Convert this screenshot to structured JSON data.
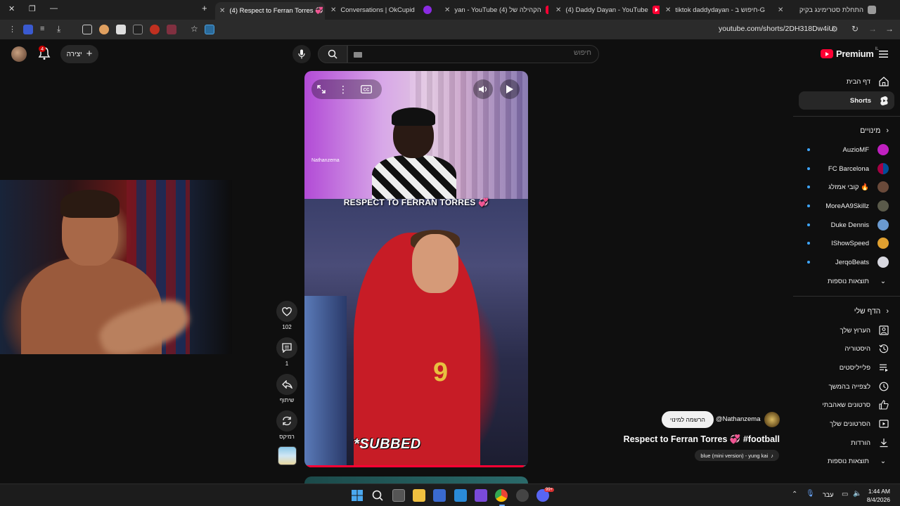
{
  "browser": {
    "tabs": [
      {
        "title": "(4) Respect to Ferran Torres 💞",
        "favicon": "youtube-icon",
        "active": true
      },
      {
        "title": "Conversations | OkCupid",
        "favicon": "okcupid-icon",
        "active": false
      },
      {
        "title": "yan - YouTube הקהילה של (4)",
        "favicon": "youtube-icon",
        "active": false
      },
      {
        "title": "(4) Daddy Dayan - YouTube",
        "favicon": "youtube-icon",
        "active": false
      },
      {
        "title": "tiktok daddydayan - חיפוש ב-G",
        "favicon": "google-icon",
        "active": false
      },
      {
        "title": "התחלת סטרימינג בקיק",
        "favicon": "twitch-icon",
        "active": false
      }
    ],
    "url": "youtube.com/shorts/2DH318Dw4iU",
    "new_tab_label": "+"
  },
  "youtube": {
    "logo_text": "Premium",
    "logo_region": "IL",
    "search": {
      "placeholder": "חיפוש"
    },
    "create_label": "יצירה",
    "notifications_count": "4"
  },
  "sidebar": {
    "nav": [
      {
        "label": "דף הבית",
        "icon": "home-icon"
      },
      {
        "label": "Shorts",
        "icon": "shorts-icon",
        "active": true
      }
    ],
    "subscriptions_header": "מינויים",
    "subscriptions": [
      {
        "label": "AuzioMF",
        "color": "#c020c0"
      },
      {
        "label": "FC Barcelona",
        "color": "#a50044"
      },
      {
        "label": "קובי אמזלג 🔥",
        "color": "#6a4a3a"
      },
      {
        "label": "MoreAA9Skillz",
        "color": "#5a5a4a"
      },
      {
        "label": "Duke Dennis",
        "color": "#6a9ad0"
      },
      {
        "label": "IShowSpeed",
        "color": "#e0a030"
      },
      {
        "label": "JerqoBeats",
        "color": "#d8d8e0"
      }
    ],
    "show_more_1": "תוצאות נוספות",
    "you_header": "הדף שלי",
    "you": [
      {
        "label": "הערוץ שלך",
        "icon": "channel-icon"
      },
      {
        "label": "היסטוריה",
        "icon": "history-icon"
      },
      {
        "label": "פלייליסטים",
        "icon": "playlist-icon"
      },
      {
        "label": "לצפייה בהמשך",
        "icon": "watch-later-icon"
      },
      {
        "label": "סרטונים שאהבתי",
        "icon": "thumb-up-icon"
      },
      {
        "label": "הסרטונים שלך",
        "icon": "your-videos-icon"
      },
      {
        "label": "הורדות",
        "icon": "download-icon"
      }
    ],
    "show_more_2": "תוצאות נוספות"
  },
  "short": {
    "caption": "RESPECT TO FERRAN TORRES 💞",
    "watermark": "Nathanzema",
    "subbed_label": "*SUBBED",
    "jersey_number": "9",
    "progress": 0.98,
    "title": "Respect to Ferran Torres 💞 #football",
    "channel_handle": "@Nathanzema",
    "subscribe_label": "הרשמה למינוי",
    "sound_label": "blue (mini version) - yung kai"
  },
  "actions": {
    "likes": "102",
    "comments": "1",
    "share_label": "שיתוף",
    "remix_label": "רמיקס"
  },
  "taskbar": {
    "lang": "עבר",
    "time": "1:44 AM",
    "date": "8/4/2026",
    "discord_badge": "99+"
  }
}
